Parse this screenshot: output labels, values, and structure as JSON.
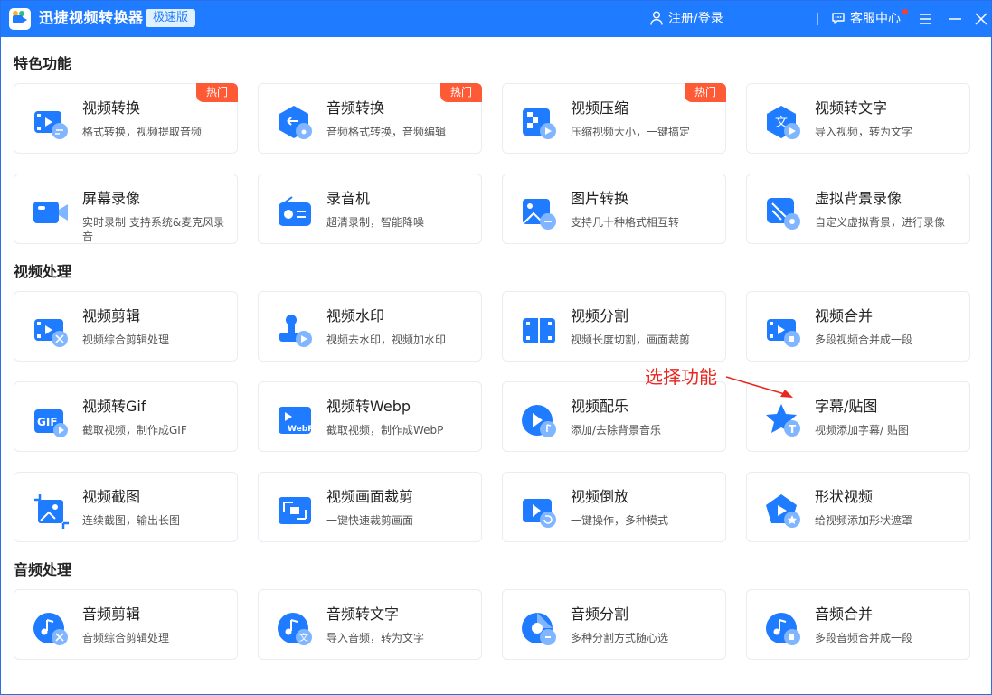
{
  "titlebar": {
    "app_title": "迅捷视频转换器",
    "edition": "极速版",
    "login": "注册/登录",
    "support": "客服中心",
    "icons": {
      "user": "user-icon",
      "chat": "chat-icon",
      "menu": "menu-icon",
      "minimize": "minimize-icon",
      "close": "close-icon"
    },
    "colors": {
      "bar": "#1f7bff",
      "hot": "#ff5a36",
      "notify": "#ff3b30"
    }
  },
  "sections": [
    {
      "title": "特色功能",
      "cards": [
        {
          "name": "视频转换",
          "desc": "格式转换，视频提取音频",
          "hot": "热门",
          "icon": "video-convert-icon"
        },
        {
          "name": "音频转换",
          "desc": "音频格式转换，音频编辑",
          "hot": "热门",
          "icon": "audio-convert-icon"
        },
        {
          "name": "视频压缩",
          "desc": "压缩视频大小，一键搞定",
          "hot": "热门",
          "icon": "video-compress-icon"
        },
        {
          "name": "视频转文字",
          "desc": "导入视频，转为文字",
          "icon": "video-to-text-icon"
        },
        {
          "name": "屏幕录像",
          "desc": "实时录制 支持系统&麦克风录音",
          "icon": "screen-record-icon"
        },
        {
          "name": "录音机",
          "desc": "超清录制，智能降噪",
          "icon": "recorder-icon"
        },
        {
          "name": "图片转换",
          "desc": "支持几十种格式相互转",
          "icon": "image-convert-icon"
        },
        {
          "name": "虚拟背景录像",
          "desc": "自定义虚拟背景，进行录像",
          "icon": "virtual-bg-icon"
        }
      ]
    },
    {
      "title": "视频处理",
      "cards": [
        {
          "name": "视频剪辑",
          "desc": "视频综合剪辑处理",
          "icon": "video-edit-icon"
        },
        {
          "name": "视频水印",
          "desc": "视频去水印，视频加水印",
          "icon": "watermark-icon"
        },
        {
          "name": "视频分割",
          "desc": "视频长度切割，画面裁剪",
          "icon": "video-split-icon"
        },
        {
          "name": "视频合并",
          "desc": "多段视频合并成一段",
          "icon": "video-merge-icon"
        },
        {
          "name": "视频转Gif",
          "desc": "截取视频，制作成GIF",
          "icon": "gif-icon"
        },
        {
          "name": "视频转Webp",
          "desc": "截取视频，制作成WebP",
          "icon": "webp-icon"
        },
        {
          "name": "视频配乐",
          "desc": "添加/去除背景音乐",
          "icon": "music-icon"
        },
        {
          "name": "字幕/贴图",
          "desc": "视频添加字幕/ 贴图",
          "icon": "subtitle-sticker-icon"
        },
        {
          "name": "视频截图",
          "desc": "连续截图，输出长图",
          "icon": "screenshot-icon"
        },
        {
          "name": "视频画面裁剪",
          "desc": "一键快速裁剪画面",
          "icon": "crop-icon"
        },
        {
          "name": "视频倒放",
          "desc": "一键操作，多种模式",
          "icon": "reverse-icon"
        },
        {
          "name": "形状视频",
          "desc": "给视频添加形状遮罩",
          "icon": "shape-icon"
        }
      ]
    },
    {
      "title": "音频处理",
      "cards": [
        {
          "name": "音频剪辑",
          "desc": "音频综合剪辑处理",
          "icon": "audio-edit-icon"
        },
        {
          "name": "音频转文字",
          "desc": "导入音频，转为文字",
          "icon": "audio-to-text-icon"
        },
        {
          "name": "音频分割",
          "desc": "多种分割方式随心选",
          "icon": "audio-split-icon"
        },
        {
          "name": "音频合并",
          "desc": "多段音频合并成一段",
          "icon": "audio-merge-icon"
        }
      ]
    }
  ],
  "annotation": {
    "text": "选择功能",
    "color": "#e8271f"
  }
}
